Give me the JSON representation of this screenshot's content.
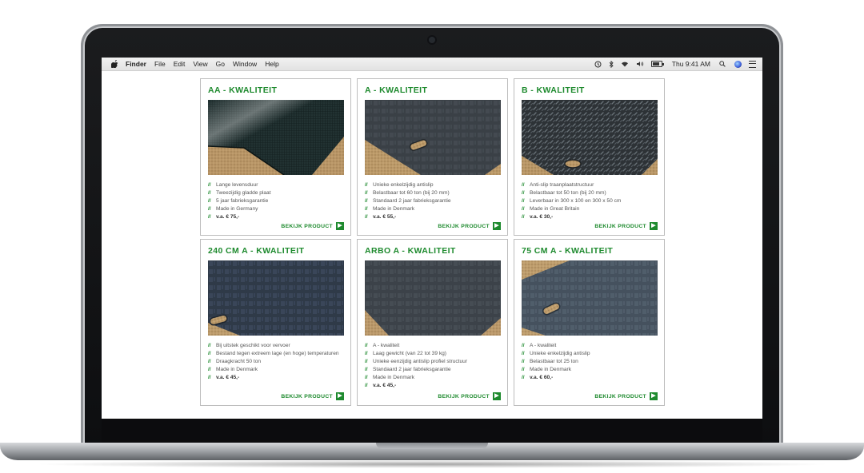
{
  "menubar": {
    "app": "Finder",
    "menus": [
      "File",
      "Edit",
      "View",
      "Go",
      "Window",
      "Help"
    ],
    "clock": "Thu 9:41 AM",
    "battery_level": 0.85
  },
  "colors": {
    "accent_green": "#1e8a2e",
    "border": "#bdbdbd",
    "text_gray": "#555555"
  },
  "icons": [
    "apple-icon",
    "time-machine-icon",
    "bluetooth-icon",
    "wifi-icon",
    "volume-icon",
    "battery-icon",
    "spotlight-search-icon",
    "siri-icon",
    "notification-center-icon",
    "arrow-right-icon"
  ],
  "products": [
    {
      "title": "AA - KWALITEIT",
      "image": "smooth-mat-photo",
      "bullets": [
        "Lange levensduur",
        "Tweezijdig gladde plaat",
        "5 jaar fabrieksgarantie",
        "Made in Germany"
      ],
      "price": "v.a. € 75,-",
      "cta": "BEKIJK PRODUCT"
    },
    {
      "title": "A - KWALITEIT",
      "image": "single-sided-antislip-mat-photo",
      "bullets": [
        "Unieke enkelzijdig antislip",
        "Belastbaar tot 60 ton (bij 20 mm)",
        "Standaard 2 jaar fabrieksgarantie",
        "Made in Denmark"
      ],
      "price": "v.a. € 55,-",
      "cta": "BEKIJK PRODUCT"
    },
    {
      "title": "B - KWALITEIT",
      "image": "tread-plate-mat-photo",
      "bullets": [
        "Anti-slip traanplaatstructuur",
        "Belastbaar tot 50 ton (bij 20 mm)",
        "Leverbaar in 300 x 100 en 300 x 50 cm",
        "Made in Great Britain"
      ],
      "price": "v.a. € 30,-",
      "cta": "BEKIJK PRODUCT"
    },
    {
      "title": "240 CM A - KWALITEIT",
      "image": "large-mat-photo",
      "bullets": [
        "Bij uitstek geschikt voor vervoer",
        "Bestand tegen extreem lage (en hoge) temperaturen",
        "Draagkracht 50 ton",
        "Made in Denmark"
      ],
      "price": "v.a. € 45,-",
      "cta": "BEKIJK PRODUCT"
    },
    {
      "title": "ARBO A - KWALITEIT",
      "image": "lightweight-mat-photo",
      "bullets": [
        "A - kwaliteit",
        "Laag gewicht (van 22 tot 39 kg)",
        "Unieke eenzijdig antislip profiel structuur",
        "Standaard 2 jaar fabrieksgarantie",
        "Made in Denmark"
      ],
      "price": "v.a. € 45,-",
      "cta": "BEKIJK PRODUCT"
    },
    {
      "title": "75 CM A - KWALITEIT",
      "image": "narrow-mat-photo",
      "bullets": [
        "A - kwaliteit",
        "Unieke enkelzijdig antislip",
        "Belastbaar tot 25 ton",
        "Made in Denmark"
      ],
      "price": "v.a. € 60,-",
      "cta": "BEKIJK PRODUCT"
    }
  ]
}
